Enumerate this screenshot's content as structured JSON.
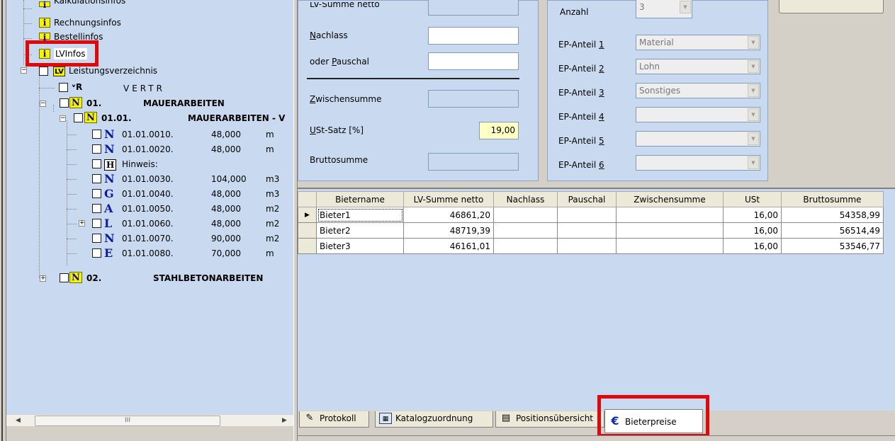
{
  "tree": {
    "info_nodes": [
      "Kalkulationsinfos",
      "Rechnungsinfos",
      "Bestellinfos",
      "LVInfos"
    ],
    "root_label": "Leistungsverzeichnis",
    "vertr_label": "VERTR",
    "group1": {
      "number": "01.",
      "title": "MAUERARBEITEN"
    },
    "subgroup1": {
      "number": "01.01.",
      "title": "MAUERARBEITEN - V"
    },
    "positions": [
      {
        "type": "N",
        "code": "01.01.0010.",
        "qty": "48,000",
        "unit": "m"
      },
      {
        "type": "N",
        "code": "01.01.0020.",
        "qty": "48,000",
        "unit": "m"
      },
      {
        "type": "H",
        "code": "Hinweis:",
        "qty": "",
        "unit": ""
      },
      {
        "type": "N",
        "code": "01.01.0030.",
        "qty": "104,000",
        "unit": "m3"
      },
      {
        "type": "G",
        "code": "01.01.0040.",
        "qty": "48,000",
        "unit": "m3"
      },
      {
        "type": "A",
        "code": "01.01.0050.",
        "qty": "48,000",
        "unit": "m2"
      },
      {
        "type": "L",
        "code": "01.01.0060.",
        "qty": "48,000",
        "unit": "m2"
      },
      {
        "type": "N",
        "code": "01.01.0070.",
        "qty": "90,000",
        "unit": "m2"
      },
      {
        "type": "E",
        "code": "01.01.0080.",
        "qty": "70,000",
        "unit": "m"
      }
    ],
    "group2": {
      "number": "02.",
      "title": "STAHLBETONARBEITEN"
    }
  },
  "form": {
    "lv_summe_netto_label": "LV-Summe netto",
    "nachlass_label": "Nachlass",
    "pauschal_label": "oder Pauschal",
    "zwischensumme_label": "Zwischensumme",
    "ust_label": "USt-Satz [%]",
    "ust_value": "19,00",
    "brutto_label": "Bruttosumme",
    "anzahl_label": "Anzahl",
    "anzahl_value": "3",
    "ep_anteile": [
      {
        "label": "EP-Anteil 1",
        "value": "Material"
      },
      {
        "label": "EP-Anteil 2",
        "value": "Lohn"
      },
      {
        "label": "EP-Anteil 3",
        "value": "Sonstiges"
      },
      {
        "label": "EP-Anteil 4",
        "value": ""
      },
      {
        "label": "EP-Anteil 5",
        "value": ""
      },
      {
        "label": "EP-Anteil 6",
        "value": ""
      }
    ]
  },
  "grid": {
    "columns": [
      "Bietername",
      "LV-Summe netto",
      "Nachlass",
      "Pauschal",
      "Zwischensumme",
      "USt",
      "Bruttosumme"
    ],
    "rows": [
      {
        "name": "Bieter1",
        "lv_summe": "46861,20",
        "nachlass": "",
        "pauschal": "",
        "zwischensumme": "",
        "ust": "16,00",
        "brutto": "54358,99"
      },
      {
        "name": "Bieter2",
        "lv_summe": "48719,39",
        "nachlass": "",
        "pauschal": "",
        "zwischensumme": "",
        "ust": "16,00",
        "brutto": "56514,49"
      },
      {
        "name": "Bieter3",
        "lv_summe": "46161,01",
        "nachlass": "",
        "pauschal": "",
        "zwischensumme": "",
        "ust": "16,00",
        "brutto": "53546,77"
      }
    ]
  },
  "tabs": [
    {
      "label": "Protokoll",
      "icon": "protocol-icon"
    },
    {
      "label": "Katalogzuordnung",
      "icon": "table-icon"
    },
    {
      "label": "Positionsübersicht",
      "icon": "overview-icon"
    },
    {
      "label": "Bieterpreise",
      "icon": "euro-icon"
    }
  ],
  "scroll": {
    "thumb_grip": "III"
  },
  "colors": {
    "panel": "#c9d9ef",
    "highlight": "#e1080c",
    "yellow": "#f7f300"
  }
}
